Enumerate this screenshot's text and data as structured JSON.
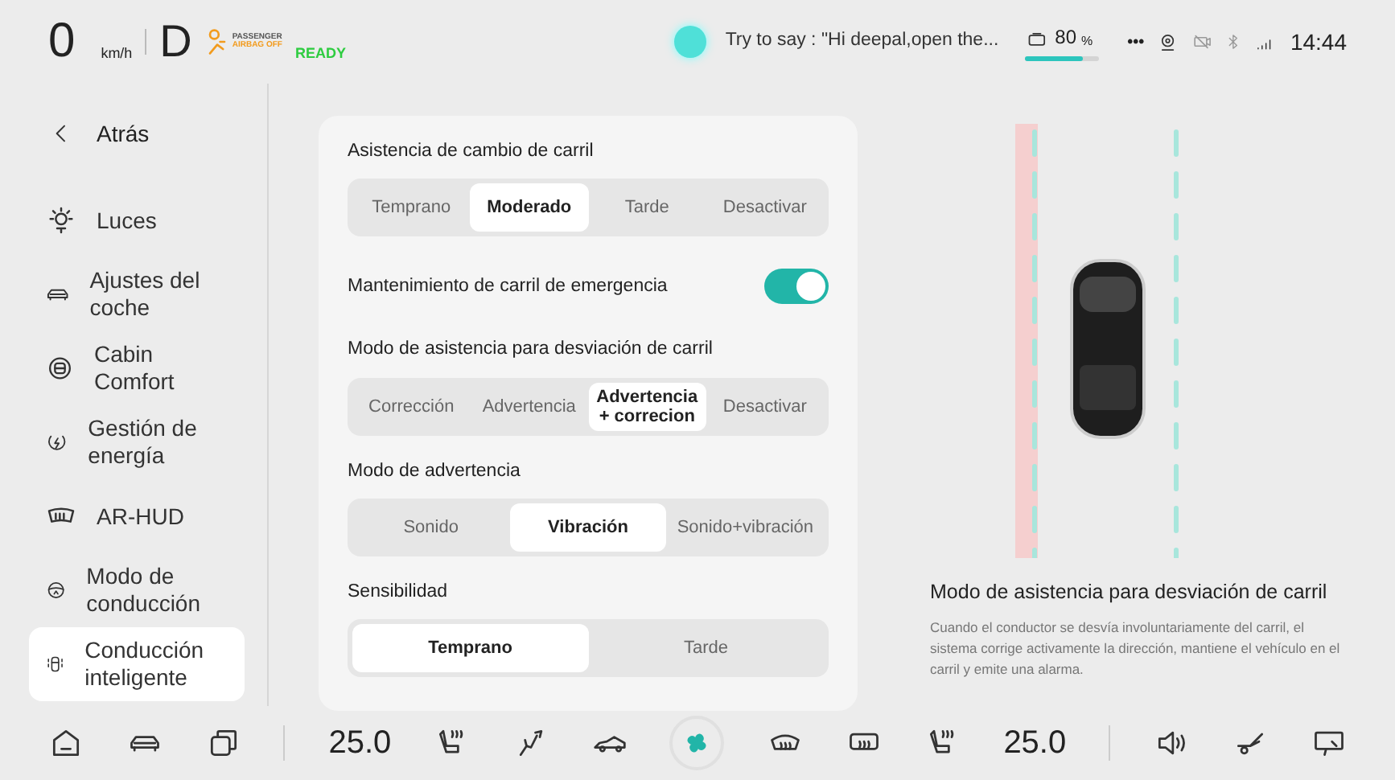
{
  "status_bar": {
    "speed": "0",
    "speed_unit": "km/h",
    "gear": "D",
    "airbag_lines": [
      "PASSENGER",
      "AIRBAG OFF"
    ],
    "ready": "READY",
    "voice_hint": "Try to say : \"Hi deepal,open the...",
    "battery": {
      "percent": "80",
      "unit": "%",
      "level": 0.8
    },
    "more": "•••",
    "time": "14:44"
  },
  "sidebar": {
    "back": "Atrás",
    "items": [
      {
        "label": "Luces",
        "selected": false
      },
      {
        "label": "Ajustes del coche",
        "selected": false
      },
      {
        "label": "Cabin Comfort",
        "selected": false
      },
      {
        "label": "Gestión de energía",
        "selected": false
      },
      {
        "label": "AR-HUD",
        "selected": false
      },
      {
        "label": "Modo de conducción",
        "selected": false
      },
      {
        "label": "Conducción inteligente",
        "selected": true
      }
    ]
  },
  "settings": [
    {
      "kind": "segmented",
      "label": "Asistencia de cambio de carril",
      "options": [
        {
          "label": "Temprano",
          "selected": false
        },
        {
          "label": "Moderado",
          "selected": true
        },
        {
          "label": "Tarde",
          "selected": false
        },
        {
          "label": "Desactivar",
          "selected": false
        }
      ]
    },
    {
      "kind": "toggle",
      "label": "Mantenimiento de carril de emergencia",
      "on": true
    },
    {
      "kind": "segmented",
      "label": "Modo de asistencia para desviación de carril",
      "options": [
        {
          "label": "Corrección",
          "selected": false
        },
        {
          "label": "Advertencia",
          "selected": false
        },
        {
          "label": "Advertencia + correcion",
          "selected": true
        },
        {
          "label": "Desactivar",
          "selected": false
        }
      ]
    },
    {
      "kind": "segmented",
      "label": "Modo de advertencia",
      "options": [
        {
          "label": "Sonido",
          "selected": false
        },
        {
          "label": "Vibración",
          "selected": true
        },
        {
          "label": "Sonido+vibración",
          "selected": false
        }
      ]
    },
    {
      "kind": "segmented",
      "label": "Sensibilidad",
      "options": [
        {
          "label": "Temprano",
          "selected": true
        },
        {
          "label": "Tarde",
          "selected": false
        }
      ]
    }
  ],
  "info": {
    "title": "Modo de asistencia para desviación de carril",
    "text": "Cuando el conductor se desvía involuntariamente del carril, el sistema corrige activamente la dirección, mantiene el vehículo en el carril y emite una alarma."
  },
  "dock": [
    {
      "kind": "icon"
    },
    {
      "kind": "icon"
    },
    {
      "kind": "icon"
    },
    {
      "kind": "sep"
    },
    {
      "kind": "temp",
      "text": "25.0"
    },
    {
      "kind": "icon"
    },
    {
      "kind": "icon"
    },
    {
      "kind": "icon"
    },
    {
      "kind": "fan"
    },
    {
      "kind": "icon"
    },
    {
      "kind": "icon"
    },
    {
      "kind": "icon"
    },
    {
      "kind": "temp",
      "text": "25.0"
    },
    {
      "kind": "sep"
    },
    {
      "kind": "icon"
    },
    {
      "kind": "icon"
    },
    {
      "kind": "icon"
    }
  ]
}
